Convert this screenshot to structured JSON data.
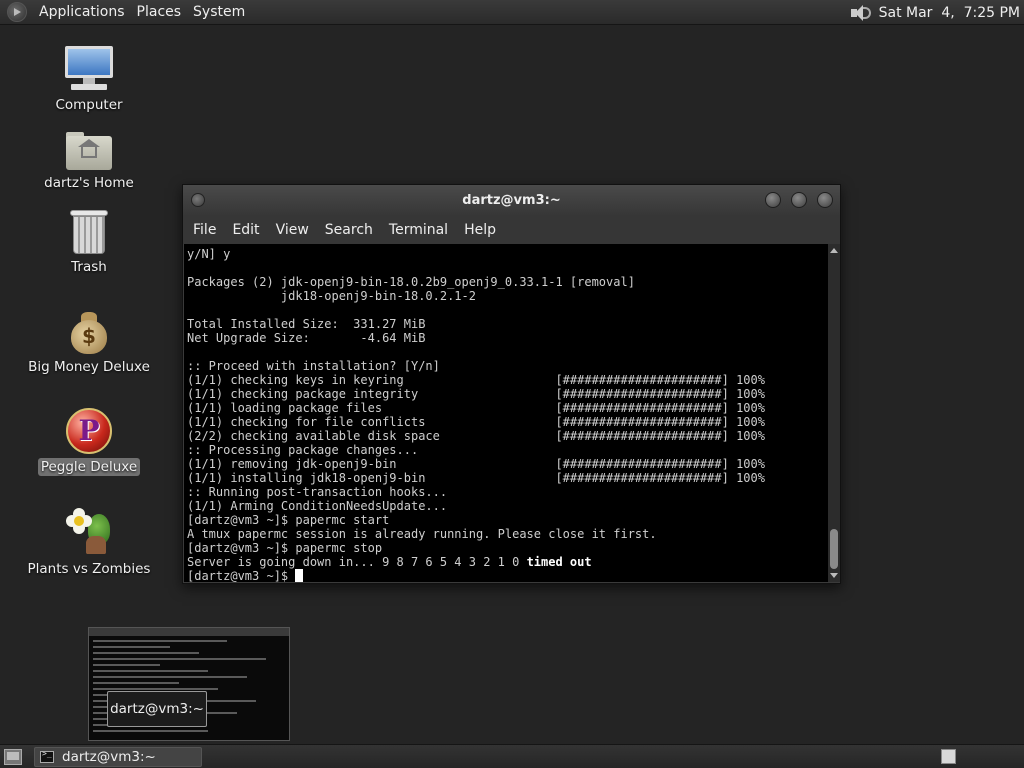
{
  "top_panel": {
    "menus": [
      "Applications",
      "Places",
      "System"
    ],
    "clock": "Sat Mar  4,  7:25 PM"
  },
  "desktop": {
    "icons": [
      {
        "label": "Computer",
        "icon": "computer-icon"
      },
      {
        "label": "dartz's Home",
        "icon": "home-folder-icon"
      },
      {
        "label": "Trash",
        "icon": "trash-icon"
      },
      {
        "label": "Big Money Deluxe",
        "icon": "money-bag-icon"
      },
      {
        "label": "Peggle Deluxe",
        "icon": "peggle-icon",
        "selected": true
      },
      {
        "label": "Plants vs Zombies",
        "icon": "plants-vs-zombies-icon"
      }
    ]
  },
  "terminal": {
    "title": "dartz@vm3:~",
    "menus": [
      "File",
      "Edit",
      "View",
      "Search",
      "Terminal",
      "Help"
    ],
    "lines": [
      "y/N] y",
      "",
      "Packages (2) jdk-openj9-bin-18.0.2b9_openj9_0.33.1-1 [removal]",
      "             jdk18-openj9-bin-18.0.2.1-2",
      "",
      "Total Installed Size:  331.27 MiB",
      "Net Upgrade Size:       -4.64 MiB",
      "",
      ":: Proceed with installation? [Y/n]",
      "(1/1) checking keys in keyring                     [######################] 100%",
      "(1/1) checking package integrity                   [######################] 100%",
      "(1/1) loading package files                        [######################] 100%",
      "(1/1) checking for file conflicts                  [######################] 100%",
      "(2/2) checking available disk space                [######################] 100%",
      ":: Processing package changes...",
      "(1/1) removing jdk-openj9-bin                      [######################] 100%",
      "(1/1) installing jdk18-openj9-bin                  [######################] 100%",
      ":: Running post-transaction hooks...",
      "(1/1) Arming ConditionNeedsUpdate...",
      "[dartz@vm3 ~]$ papermc start",
      "A tmux papermc session is already running. Please close it first.",
      "[dartz@vm3 ~]$ papermc stop"
    ],
    "server_line": "Server is going down in... 9 8 7 6 5 4 3 2 1 0 ",
    "timed_out": "timed out",
    "prompt": "[dartz@vm3 ~]$ "
  },
  "preview": {
    "tooltip": "dartz@vm3:~"
  },
  "taskbar": {
    "task_label": "dartz@vm3:~"
  }
}
